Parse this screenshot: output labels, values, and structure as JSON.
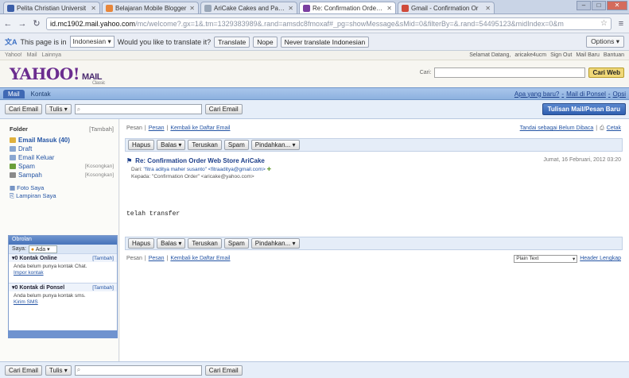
{
  "browser": {
    "tabs": [
      {
        "label": "Pelita Christian Universit",
        "color": "#3b5ea8",
        "active": false
      },
      {
        "label": "Belajaran Mobile Blogger",
        "color": "#e8863a",
        "active": false
      },
      {
        "label": "AriCake Cakes and Pastri",
        "color": "#9aa7b8",
        "active": false
      },
      {
        "label": "Re: Confirmation Order W",
        "color": "#7b3fa0",
        "active": true
      },
      {
        "label": "Gmail - Confirmation Or",
        "color": "#d04a3a",
        "active": false
      }
    ],
    "url_host": "id.mc1902.mail.yahoo.com",
    "url_path": "/mc/welcome?.gx=1&.tm=1329383989&.rand=amsdc8fmoxaf#_pg=showMessage&sMid=0&filterBy=&.rand=54495123&midIndex=0&m"
  },
  "translate_bar": {
    "prefix": "This page is in",
    "language": "Indonesian",
    "question": "Would you like to translate it?",
    "translate_btn": "Translate",
    "nope_btn": "Nope",
    "never_btn": "Never translate Indonesian",
    "options_btn": "Options"
  },
  "yahoo_top": {
    "left_links": [
      "Yahoo!",
      "Mail",
      "Lainnya"
    ],
    "right_links": [
      "Selamat Datang,",
      "aricake4ucm",
      "Sign Out",
      "Mail Baru",
      "Bantuan"
    ]
  },
  "header": {
    "logo": "YAHOO!",
    "logo_mail": "MAIL",
    "logo_classic": "Classic",
    "search_label": "Cari:",
    "search_btn": "Cari Web"
  },
  "nav": {
    "tabs": [
      "Mail",
      "Kontak"
    ],
    "right_links": [
      "Apa yang baru?",
      "-",
      "Mail di Ponsel",
      "-",
      "Opsi"
    ]
  },
  "toolbar": {
    "search_btn": "Cari Email",
    "tools_btn": "Tulis",
    "mail_search_btn": "Cari Email",
    "compose_btn": "Tulisan Mail/Pesan Baru"
  },
  "sidebar": {
    "title": "Folder",
    "action": "[Tambah]",
    "folders": [
      {
        "label": "Email Masuk (40)",
        "count": "",
        "color": "#e0b13c"
      },
      {
        "label": "Draft",
        "count": "",
        "color": "#8aa7d1"
      },
      {
        "label": "Email Keluar",
        "count": "",
        "color": "#8aa7d1"
      },
      {
        "label": "Spam",
        "count": "[Kosongkan]",
        "color": "#6a9f3a"
      },
      {
        "label": "Sampah",
        "count": "[Kosongkan]",
        "color": "#8a8a8a"
      }
    ],
    "extra": [
      "Foto Saya",
      "Lampiran Saya"
    ],
    "chat": {
      "title": "Obrolan",
      "status_label": "Saya:",
      "status_value": "Ada",
      "online_header": "0 Kontak Online",
      "online_link": "[Tambah]",
      "online_text": "Anda belum punya kontak Chat.",
      "online_link2": "Impor kontak",
      "phone_header": "0 Kontak di Ponsel",
      "phone_link": "[Tambah]",
      "phone_text": "Anda belum punya kontak sms.",
      "phone_link2": "Kirim SMS"
    }
  },
  "message": {
    "top_links": {
      "prev": "Pesan",
      "next": "Pesan",
      "back": "Kembali ke Daftar Email",
      "right": "Tandai sebagai Belum Dibaca",
      "print": "Cetak"
    },
    "actions": [
      "Hapus",
      "Balas",
      "Teruskan",
      "Spam",
      "Pindahkan..."
    ],
    "subject": "Re: Confirmation Order Web Store AriCake",
    "date": "Jumat, 16 Februari, 2012 03:20",
    "from_label": "Dari:",
    "from_value": "\"fitra aditya maher susanto\" <fitraaditya@gmail.com>",
    "to_label": "Kepada:",
    "to_value": "\"Confirmation Order\" <aricake@yahoo.com>",
    "body": "telah transfer",
    "bottom_links": {
      "prev": "Pesan",
      "next": "Pesan",
      "back": "Kembali ke Daftar Email",
      "select": "Plain Text",
      "headers": "Header Lengkap"
    }
  },
  "bottom": {
    "search_btn": "Cari Email",
    "tools_btn": "Tulis",
    "mail_search_btn": "Cari Email"
  }
}
